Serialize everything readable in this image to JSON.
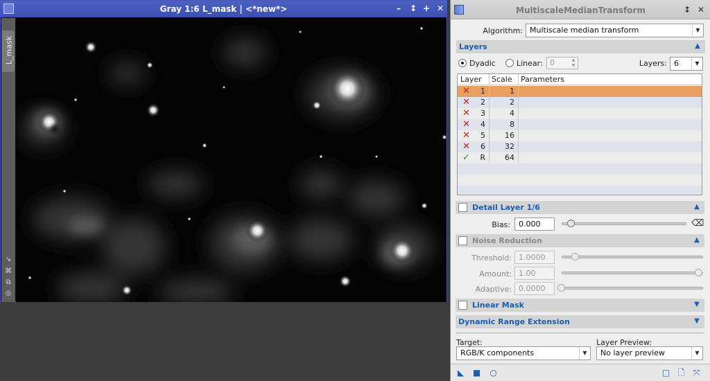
{
  "image_window": {
    "title": "Gray 1:6 L_mask | <*new*>",
    "side_tab_label": "L_mask",
    "buttons": {
      "minimize": "–",
      "shade": "↕",
      "maximize": "+",
      "close": "✕"
    }
  },
  "dialog": {
    "title": "MultiscaleMedianTransform",
    "algorithm_label": "Algorithm:",
    "algorithm_value": "Multiscale median transform",
    "layers_section": "Layers",
    "dyadic_label": "Dyadic",
    "linear_label": "Linear:",
    "linear_value": "0",
    "layers_label": "Layers:",
    "layers_value": "6",
    "table": {
      "headers": [
        "Layer",
        "Scale",
        "Parameters"
      ],
      "rows": [
        {
          "layer": "1",
          "scale": "1",
          "enabled": false
        },
        {
          "layer": "2",
          "scale": "2",
          "enabled": false
        },
        {
          "layer": "3",
          "scale": "4",
          "enabled": false
        },
        {
          "layer": "4",
          "scale": "8",
          "enabled": false
        },
        {
          "layer": "5",
          "scale": "16",
          "enabled": false
        },
        {
          "layer": "6",
          "scale": "32",
          "enabled": false
        },
        {
          "layer": "R",
          "scale": "64",
          "enabled": true
        }
      ]
    },
    "detail_layer_section": "Detail Layer 1/6",
    "bias_label": "Bias:",
    "bias_value": "0.000",
    "noise_reduction_section": "Noise Reduction",
    "threshold_label": "Threshold:",
    "threshold_value": "1.0000",
    "amount_label": "Amount:",
    "amount_value": "1.00",
    "adaptive_label": "Adaptive:",
    "adaptive_value": "0.0000",
    "linear_mask_section": "Linear Mask",
    "dre_section": "Dynamic Range Extension",
    "target_label": "Target:",
    "target_value": "RGB/K components",
    "layer_preview_label": "Layer Preview:",
    "layer_preview_value": "No layer preview"
  },
  "colors": {
    "image_title_bar": "#3b4fb0",
    "selected_row": "#e8a060",
    "section_title": "#1a5fb4",
    "disabled_mark": "#d81818",
    "enabled_mark": "#2a9a2a"
  }
}
